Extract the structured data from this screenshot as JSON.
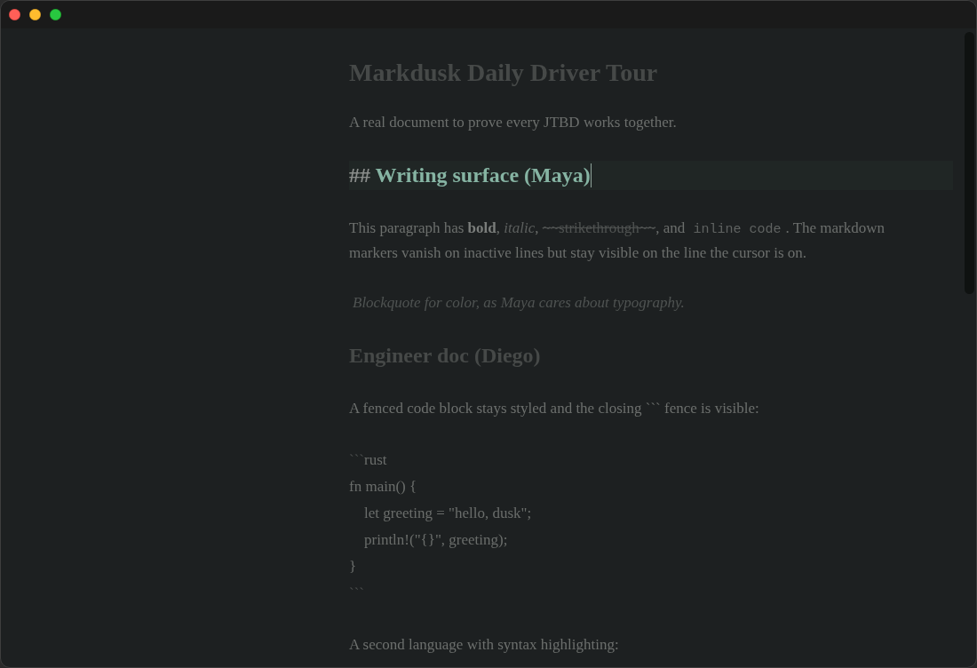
{
  "document": {
    "blocks": [
      {
        "kind": "title",
        "text": "Markdusk Daily Driver Tour",
        "active": false
      },
      {
        "kind": "paragraph",
        "text": "A real document to prove every JTBD works together."
      },
      {
        "kind": "heading",
        "marker": "##",
        "text": "Writing surface (Maya)",
        "active": true
      },
      {
        "kind": "paragraph",
        "segments": [
          {
            "kind": "text",
            "text": "This paragraph has "
          },
          {
            "kind": "bold",
            "text": "bold"
          },
          {
            "kind": "text",
            "text": ", "
          },
          {
            "kind": "italic",
            "text": "italic"
          },
          {
            "kind": "text",
            "text": ", "
          },
          {
            "kind": "strike",
            "text": "~~strikethrough~~"
          },
          {
            "kind": "text",
            "text": ", and "
          },
          {
            "kind": "code",
            "text": "inline code"
          },
          {
            "kind": "text",
            "text": ". The markdown markers vanish on inactive lines but stay visible on the line the cursor is on."
          }
        ]
      },
      {
        "kind": "blockquote",
        "text": "Blockquote for color, as Maya cares about typography."
      },
      {
        "kind": "heading",
        "text": "Engineer doc (Diego)",
        "active": false
      },
      {
        "kind": "paragraph",
        "text": "A fenced code block stays styled and the closing ``` fence is visible:"
      },
      {
        "kind": "code_block",
        "lines": [
          {
            "kind": "fence",
            "marker": "```",
            "text": "rust"
          },
          {
            "kind": "code",
            "text": "fn main() {"
          },
          {
            "kind": "code",
            "text": "    let greeting = \"hello, dusk\";"
          },
          {
            "kind": "code",
            "text": "    println!(\"{}\", greeting);"
          },
          {
            "kind": "code",
            "text": "}"
          },
          {
            "kind": "fence",
            "marker": "```"
          }
        ]
      },
      {
        "kind": "paragraph",
        "text": "A second language with syntax highlighting:"
      }
    ]
  }
}
